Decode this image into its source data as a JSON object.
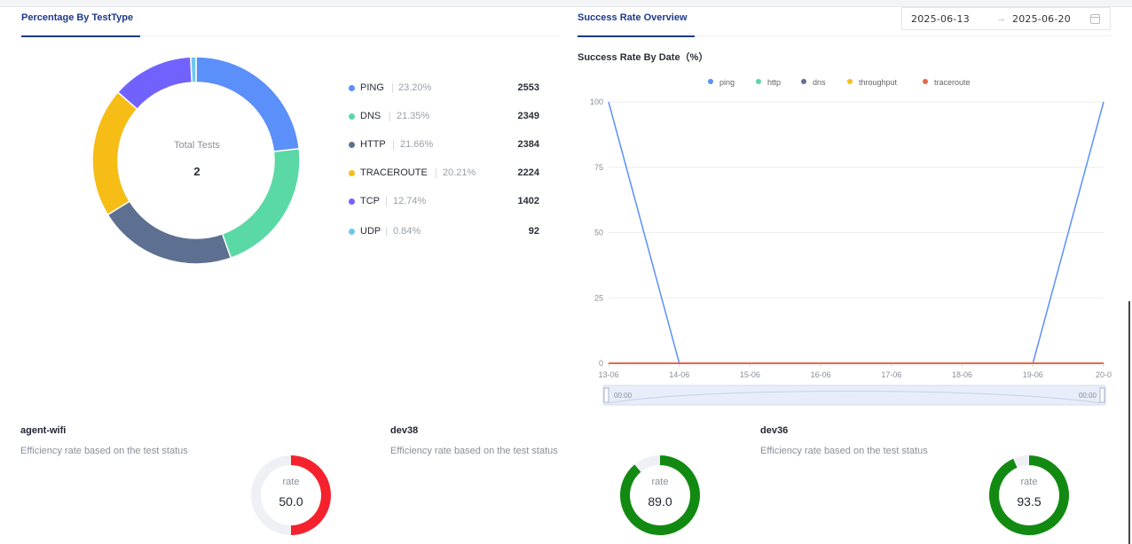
{
  "left_panel": {
    "title": "Percentage By TestType",
    "donut": {
      "center_label": "Total Tests",
      "center_value": "2"
    },
    "legend": [
      {
        "name": "PING",
        "percent": "23.20%",
        "count": "2553",
        "color": "#5b8ff9"
      },
      {
        "name": "DNS",
        "percent": "21.35%",
        "count": "2349",
        "color": "#5ad8a6"
      },
      {
        "name": "HTTP",
        "percent": "21.66%",
        "count": "2384",
        "color": "#5d7092"
      },
      {
        "name": "TRACEROUTE",
        "percent": "20.21%",
        "count": "2224",
        "color": "#f6bd16"
      },
      {
        "name": "TCP",
        "percent": "12.74%",
        "count": "1402",
        "color": "#7262fd"
      },
      {
        "name": "UDP",
        "percent": "0.84%",
        "count": "92",
        "color": "#6dc8ec"
      }
    ]
  },
  "right_panel": {
    "title": "Success Rate Overview",
    "date_range": {
      "start": "2025-06-13",
      "arrow": "→",
      "end": "2025-06-20"
    },
    "chart_title": "Success Rate By Date（%）",
    "slider": {
      "start_label": "00:00",
      "end_label": "00:00"
    }
  },
  "chart_data": {
    "type": "line",
    "title": "Success Rate By Date（%）",
    "x": [
      "13-06",
      "14-06",
      "15-06",
      "16-06",
      "17-06",
      "18-06",
      "19-06",
      "20-0"
    ],
    "yticks": [
      0,
      25,
      50,
      75,
      100
    ],
    "ylim": [
      0,
      100
    ],
    "grid": true,
    "legend_position": "top",
    "series": [
      {
        "name": "ping",
        "color": "#5b8ff9",
        "values": [
          100,
          0,
          0,
          0,
          0,
          0,
          0,
          100
        ]
      },
      {
        "name": "http",
        "color": "#5ad8a6",
        "values": [
          0,
          0,
          0,
          0,
          0,
          0,
          0,
          0
        ]
      },
      {
        "name": "dns",
        "color": "#5d7092",
        "values": [
          0,
          0,
          0,
          0,
          0,
          0,
          0,
          0
        ]
      },
      {
        "name": "throughput",
        "color": "#f6bd16",
        "values": [
          0,
          0,
          0,
          0,
          0,
          0,
          0,
          0
        ]
      },
      {
        "name": "traceroute",
        "color": "#e8684a",
        "values": [
          0,
          0,
          0,
          0,
          0,
          0,
          0,
          0
        ]
      }
    ]
  },
  "agents": [
    {
      "name": "agent-wifi",
      "description": "Efficiency rate based on the test status",
      "rate_label": "rate",
      "rate": "50.0",
      "rate_fraction": 0.5,
      "color": "#f5222d"
    },
    {
      "name": "dev38",
      "description": "Efficiency rate based on the test status",
      "rate_label": "rate",
      "rate": "89.0",
      "rate_fraction": 0.89,
      "color": "#128a12"
    },
    {
      "name": "dev36",
      "description": "Efficiency rate based on the test status",
      "rate_label": "rate",
      "rate": "93.5",
      "rate_fraction": 0.935,
      "color": "#128a12"
    }
  ]
}
